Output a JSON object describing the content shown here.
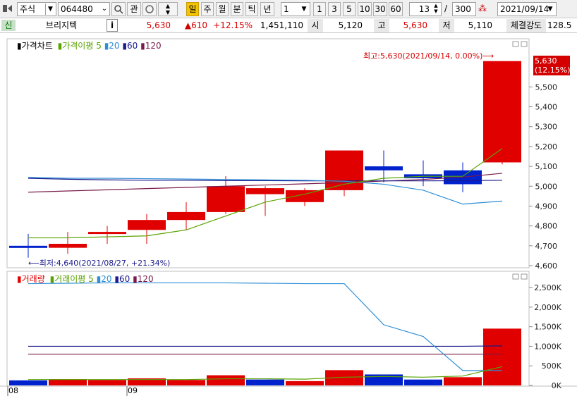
{
  "toolbar": {
    "market": "주식",
    "code": "064480",
    "gwan": "관",
    "periods": [
      "일",
      "주",
      "월",
      "분",
      "틱",
      "년"
    ],
    "period_count": "1",
    "quick_nums": [
      "1",
      "3",
      "5",
      "10",
      "30",
      "60"
    ],
    "count": "13",
    "total": "300",
    "slash": "/",
    "date": "2021/09/14"
  },
  "quote": {
    "badge": "신",
    "name": "브리지텍",
    "info": "i",
    "price": "5,630",
    "change": "▲610",
    "change_pct": "+12.15%",
    "volume": "1,451,110",
    "open_label": "시",
    "open": "5,120",
    "high_label": "고",
    "high": "5,630",
    "low_label": "저",
    "low": "5,110",
    "strength_label": "체결강도",
    "strength": "128.5"
  },
  "price_legend": {
    "title": "가격차트",
    "ma_label": "가격이평",
    "ma": [
      "5",
      "20",
      "60",
      "120"
    ]
  },
  "volume_legend": {
    "title": "거래량",
    "ma_label": "거래이평",
    "ma": [
      "5",
      "20",
      "60",
      "120"
    ]
  },
  "colors": {
    "up": "#e00000",
    "down": "#0022cc",
    "ma5": "#5aa300",
    "ma20": "#2d8ed6",
    "ma60": "#1a1a8c",
    "ma120": "#7a1a4a"
  },
  "chart_data": [
    {
      "type": "candlestick",
      "title": "가격차트",
      "ylim": [
        4600,
        5700
      ],
      "yticks": [
        4600,
        4700,
        4800,
        4900,
        5000,
        5100,
        5200,
        5300,
        5400,
        5500
      ],
      "ytick_labels": [
        "4,600",
        "4,700",
        "4,800",
        "4,900",
        "5,000",
        "5,100",
        "5,200",
        "5,300",
        "5,400",
        "5,500"
      ],
      "candles": [
        {
          "o": 4700,
          "h": 4760,
          "l": 4640,
          "c": 4690
        },
        {
          "o": 4690,
          "h": 4770,
          "l": 4660,
          "c": 4710
        },
        {
          "o": 4770,
          "h": 4800,
          "l": 4710,
          "c": 4770
        },
        {
          "o": 4780,
          "h": 4860,
          "l": 4710,
          "c": 4830
        },
        {
          "o": 4830,
          "h": 4920,
          "l": 4780,
          "c": 4870
        },
        {
          "o": 4870,
          "h": 5050,
          "l": 4860,
          "c": 5000
        },
        {
          "o": 4960,
          "h": 5000,
          "l": 4850,
          "c": 4990
        },
        {
          "o": 4920,
          "h": 4990,
          "l": 4900,
          "c": 4980
        },
        {
          "o": 4980,
          "h": 5180,
          "l": 4950,
          "c": 5180
        },
        {
          "o": 5100,
          "h": 5180,
          "l": 5020,
          "c": 5080
        },
        {
          "o": 5060,
          "h": 5130,
          "l": 5000,
          "c": 5040
        },
        {
          "o": 5080,
          "h": 5120,
          "l": 4970,
          "c": 5010
        },
        {
          "o": 5120,
          "h": 5630,
          "l": 5110,
          "c": 5630
        }
      ],
      "ma5": [
        4740,
        4740,
        4745,
        4750,
        4780,
        4850,
        4920,
        4960,
        5010,
        5040,
        5050,
        5050,
        5190
      ],
      "ma20": [
        5045,
        5040,
        5040,
        5038,
        5036,
        5034,
        5032,
        5030,
        5025,
        5010,
        4980,
        4910,
        4925
      ],
      "ma60": [
        5040,
        5035,
        5032,
        5030,
        5030,
        5028,
        5028,
        5027,
        5027,
        5027,
        5027,
        5028,
        5030
      ],
      "ma120": [
        4970,
        4976,
        4982,
        4988,
        4994,
        5000,
        5006,
        5012,
        5018,
        5026,
        5034,
        5046,
        5065
      ],
      "high_note": "최고:5,630(2021/09/14, 0.00%)⟶",
      "low_note": "⟵최저:4,640(2021/08/27, +21.34%)",
      "last_price": "5,630",
      "last_pct": "(12.15%)"
    },
    {
      "type": "bar",
      "title": "거래량",
      "ylim": [
        0,
        2700000
      ],
      "yticks": [
        0,
        500000,
        1000000,
        1500000,
        2000000,
        2500000
      ],
      "ytick_labels": [
        "0K",
        "500K",
        "1,000K",
        "1,500K",
        "2,000K",
        "2,500K"
      ],
      "values": [
        130000,
        160000,
        140000,
        180000,
        140000,
        260000,
        150000,
        110000,
        390000,
        280000,
        150000,
        210000,
        1451110
      ],
      "up": [
        false,
        true,
        true,
        true,
        true,
        true,
        false,
        true,
        true,
        false,
        false,
        true,
        true
      ],
      "ma5": [
        150000,
        150000,
        150000,
        150000,
        150000,
        170000,
        170000,
        160000,
        210000,
        230000,
        210000,
        240000,
        480000
      ],
      "ma20": [
        2600000,
        2610000,
        2620000,
        2620000,
        2620000,
        2620000,
        2610000,
        2600000,
        2600000,
        1550000,
        1250000,
        380000,
        380000
      ],
      "ma60": [
        1000000,
        1000000,
        1000000,
        1000000,
        1000000,
        1000000,
        1000000,
        1000000,
        1000000,
        1000000,
        1000000,
        1000000,
        1010000
      ],
      "ma120": [
        800000,
        800000,
        800000,
        800000,
        800000,
        800000,
        800000,
        800000,
        800000,
        800000,
        800000,
        800000,
        800000
      ]
    }
  ],
  "x_axis": {
    "labels": [
      "08",
      "09"
    ]
  }
}
